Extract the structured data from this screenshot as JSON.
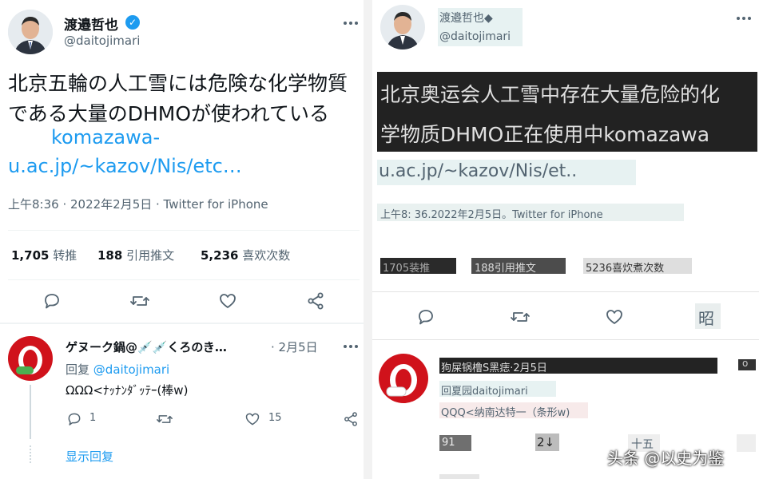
{
  "left": {
    "author": {
      "name": "渡邉哲也",
      "handle": "@daitojimari",
      "verified": true
    },
    "tweet_text": "北京五輪の人工雪には危険な化学物質である大量のDHMOが使われている",
    "link_line1": "komazawa-",
    "link_line2": "u.ac.jp/~kazov/Nis/etc…",
    "timestamp": "上午8:36 · 2022年2月5日 · Twitter for iPhone",
    "stats": {
      "retweets": "1,705",
      "retweets_label": "转推",
      "quotes": "188",
      "quotes_label": "引用推文",
      "likes": "5,236",
      "likes_label": "喜欢次数"
    },
    "reply": {
      "name": "ゲヌーク鍋@💉💉くろのき…",
      "date": "· 2月5日",
      "reply_to_prefix": "回复",
      "reply_to": "@daitojimari",
      "text": "ΩΩΩ<ﾅｯﾅﾝﾀﾞｯﾃｰ(棒w)",
      "reply_count": "1",
      "like_count": "15",
      "show_replies": "显示回复"
    }
  },
  "right": {
    "author": {
      "name": "渡邉哲也◆",
      "handle": "@daitojimari"
    },
    "tweet_line1": "北京奥运会人工雪中存在大量危险的化",
    "tweet_line2": "学物质DHMO正在使用中komazawa",
    "link_line": "u.ac.jp/~kazov/Nis/et..",
    "timestamp": "上午8:  36.2022年2月5日。Twitter for iPhone",
    "stats": {
      "retweets": "1705装推",
      "quotes": "188引用推文",
      "likes": "5236喜炊煮次数"
    },
    "share_glyph": "昭",
    "reply": {
      "name_line": "狗屎锅橹S黑痣·2月5日",
      "more_glyph": "o",
      "reply_to": "回夏园daitojimari",
      "text": "QQQ<纳南达特一（条形w)",
      "reply_count": "91",
      "retweet_count": "2↓",
      "like_count": "十五"
    }
  },
  "watermark": "头条 @以史为鉴"
}
